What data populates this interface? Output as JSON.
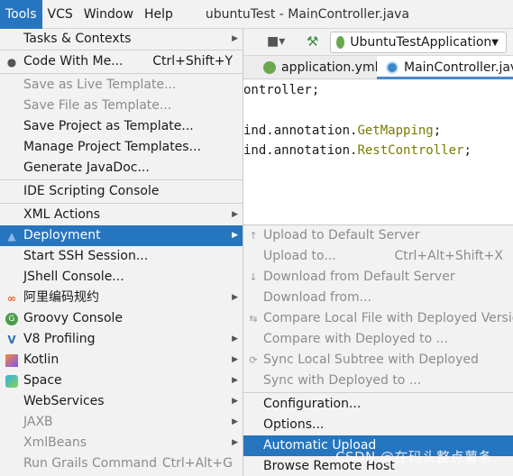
{
  "menubar": {
    "items": [
      "Tools",
      "VCS",
      "Window",
      "Help"
    ],
    "title": "ubuntuTest - MainController.java"
  },
  "toolbar": {
    "run_config": "UbuntuTestApplication"
  },
  "tabs": [
    {
      "label": "application.yml",
      "close": "×"
    },
    {
      "label": "MainController.java"
    }
  ],
  "editor": {
    "lines": [
      {
        "pre": "ontroller;",
        "str": ""
      },
      {
        "pre": "ind.annotation.",
        "str": "GetMapping",
        "post": ";"
      },
      {
        "pre": "ind.annotation.",
        "str": "RestController",
        "post": ";"
      }
    ]
  },
  "tools_menu": {
    "items": [
      {
        "label": "Tasks & Contexts",
        "submenu": true
      },
      {
        "label": "Code With Me...",
        "shortcut": "Ctrl+Shift+Y",
        "icon": "user-icon"
      },
      {
        "label": "Save as Live Template...",
        "disabled": true
      },
      {
        "label": "Save File as Template...",
        "disabled": true
      },
      {
        "label": "Save Project as Template..."
      },
      {
        "label": "Manage Project Templates..."
      },
      {
        "label": "Generate JavaDoc..."
      },
      {
        "label": "IDE Scripting Console"
      },
      {
        "label": "XML Actions",
        "submenu": true
      },
      {
        "label": "Deployment",
        "submenu": true,
        "selected": true,
        "icon": "deployment-icon"
      },
      {
        "label": "Start SSH Session..."
      },
      {
        "label": "JShell Console..."
      },
      {
        "label": "阿里编码规约",
        "submenu": true,
        "icon": "alibaba-icon"
      },
      {
        "label": "Groovy Console",
        "icon": "groovy-icon"
      },
      {
        "label": "V8 Profiling",
        "submenu": true,
        "icon": "v8-icon"
      },
      {
        "label": "Kotlin",
        "submenu": true,
        "icon": "kotlin-icon"
      },
      {
        "label": "Space",
        "submenu": true,
        "icon": "space-icon"
      },
      {
        "label": "WebServices",
        "submenu": true
      },
      {
        "label": "JAXB",
        "submenu": true,
        "disabled": true
      },
      {
        "label": "XmlBeans",
        "submenu": true,
        "disabled": true
      },
      {
        "label": "Run Grails Command",
        "shortcut": "Ctrl+Alt+G",
        "disabled": true
      }
    ]
  },
  "deployment_menu": {
    "items": [
      {
        "label": "Upload to Default Server",
        "disabled": true,
        "icon": "upload-icon"
      },
      {
        "label": "Upload to...",
        "shortcut": "Ctrl+Alt+Shift+X",
        "disabled": true
      },
      {
        "label": "Download from Default Server",
        "disabled": true,
        "icon": "download-icon"
      },
      {
        "label": "Download from...",
        "disabled": true
      },
      {
        "label": "Compare Local File with Deployed Version",
        "disabled": true,
        "icon": "compare-icon"
      },
      {
        "label": "Compare with Deployed to ...",
        "disabled": true
      },
      {
        "label": "Sync Local Subtree with Deployed",
        "disabled": true,
        "icon": "sync-icon"
      },
      {
        "label": "Sync with Deployed to ...",
        "disabled": true
      },
      {
        "label": "Configuration..."
      },
      {
        "label": "Options..."
      },
      {
        "label": "Automatic Upload",
        "selected": true
      },
      {
        "label": "Browse Remote Host"
      }
    ]
  },
  "watermark": "CSDN @在码头整点薯条"
}
